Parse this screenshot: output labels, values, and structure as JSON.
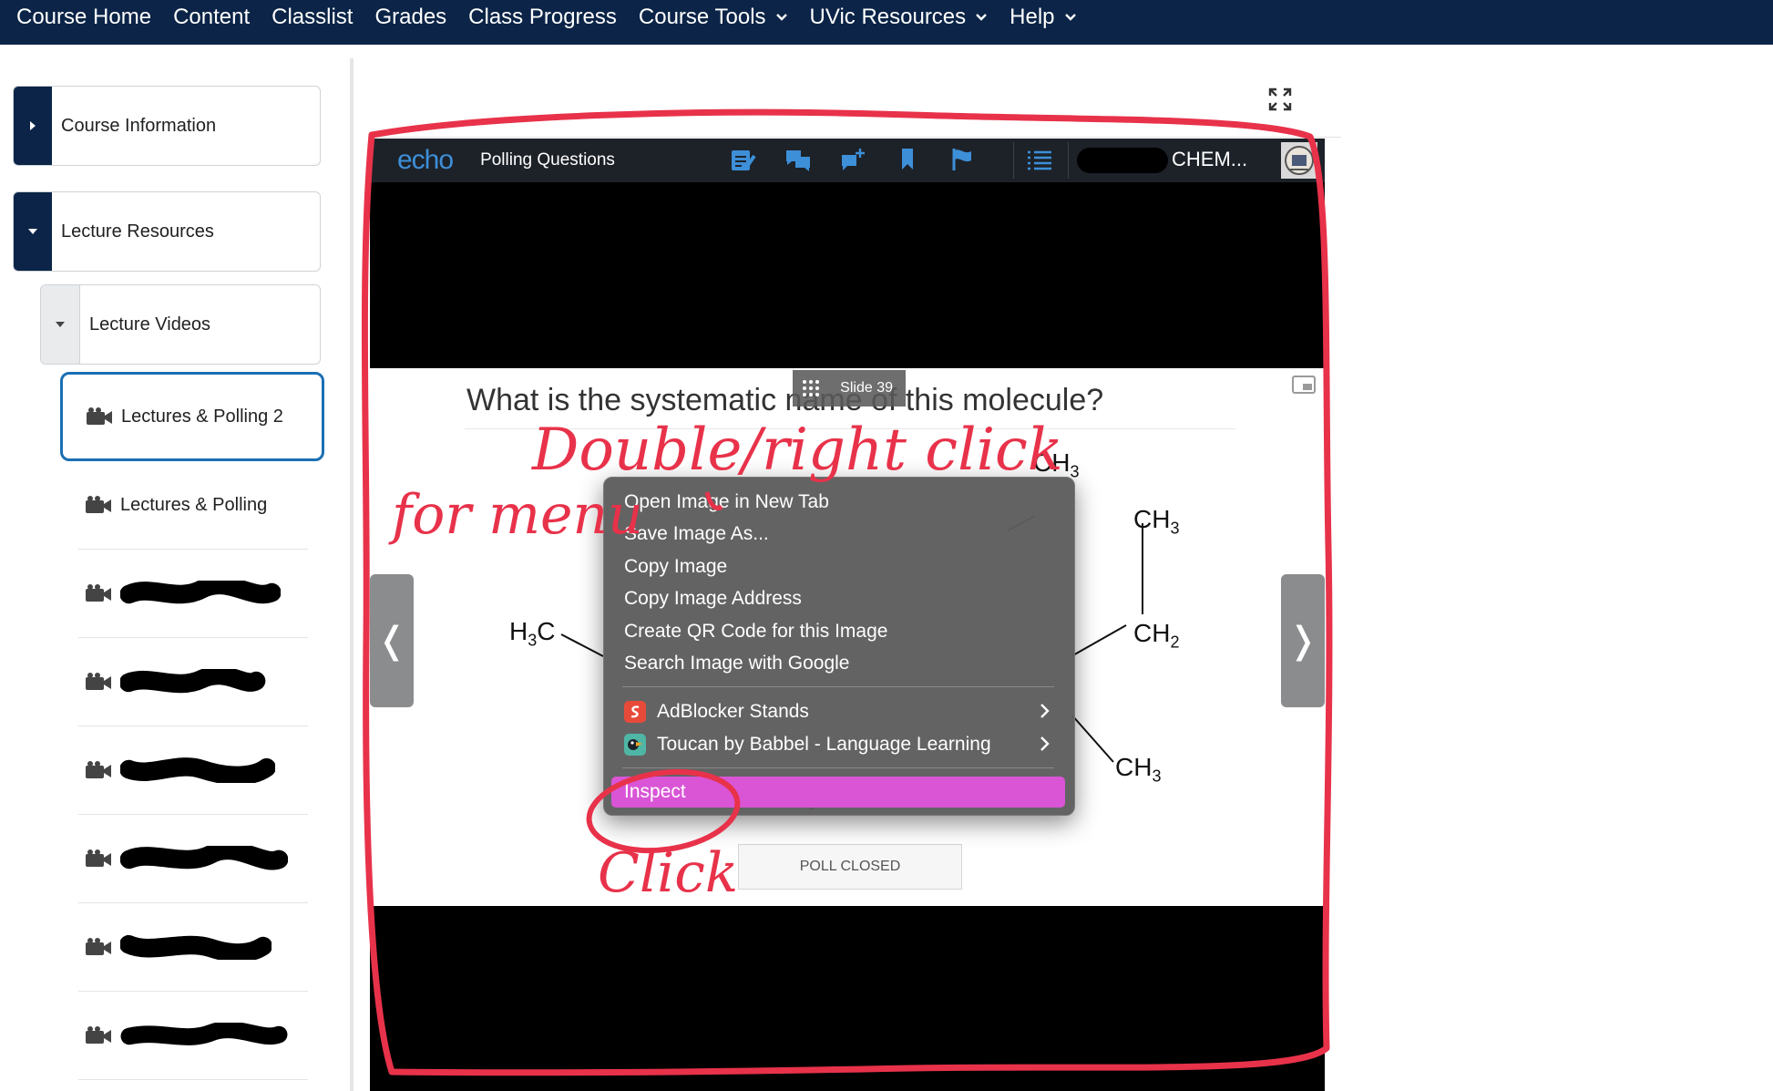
{
  "topnav": {
    "items": [
      {
        "label": "Course Home",
        "dropdown": false
      },
      {
        "label": "Content",
        "dropdown": false
      },
      {
        "label": "Classlist",
        "dropdown": false
      },
      {
        "label": "Grades",
        "dropdown": false
      },
      {
        "label": "Class Progress",
        "dropdown": false
      },
      {
        "label": "Course Tools",
        "dropdown": true
      },
      {
        "label": "UVic Resources",
        "dropdown": true
      },
      {
        "label": "Help",
        "dropdown": true
      }
    ],
    "background": "#0b2447"
  },
  "sidebar": {
    "course_information": "Course Information",
    "lecture_resources": "Lecture Resources",
    "lecture_videos": "Lecture Videos",
    "selected_item": "Lectures & Polling 2",
    "item_2": "Lectures & Polling",
    "redacted_items_count_label": "6 redacted items",
    "accent": "#1b6fb4"
  },
  "player": {
    "logo": "echo",
    "title": "Polling Questions",
    "course": "CHEM...",
    "header_icons": [
      "notes-icon",
      "discussion-icon",
      "add-question-icon",
      "bookmark-icon",
      "flag-icon",
      "list-icon"
    ]
  },
  "slide": {
    "badge": "Slide 39",
    "question": "What is the systematic name of this molecule?",
    "poll_status": "POLL CLOSED",
    "prev_arrow": "❬",
    "next_arrow": "❭",
    "molecule_labels": {
      "h3c": [
        "H",
        "3",
        "C"
      ],
      "ch3_top": [
        "CH",
        "3"
      ],
      "ch3_right": [
        "CH",
        "3"
      ],
      "ch2": [
        "CH",
        "2"
      ],
      "ch3_bottom": [
        "CH",
        "3"
      ]
    }
  },
  "context_menu": {
    "items": [
      "Open Image in New Tab",
      "Save Image As...",
      "Copy Image",
      "Copy Image Address",
      "Create QR Code for this Image",
      "Search Image with Google"
    ],
    "extensions": [
      "AdBlocker Stands",
      "Toucan by Babbel - Language Learning"
    ],
    "inspect": "Inspect",
    "highlight": "#d955d6"
  },
  "annotations": {
    "line1": "Double/right click",
    "line2": "for menu",
    "line3": "Click",
    "color": "#e8324a"
  }
}
